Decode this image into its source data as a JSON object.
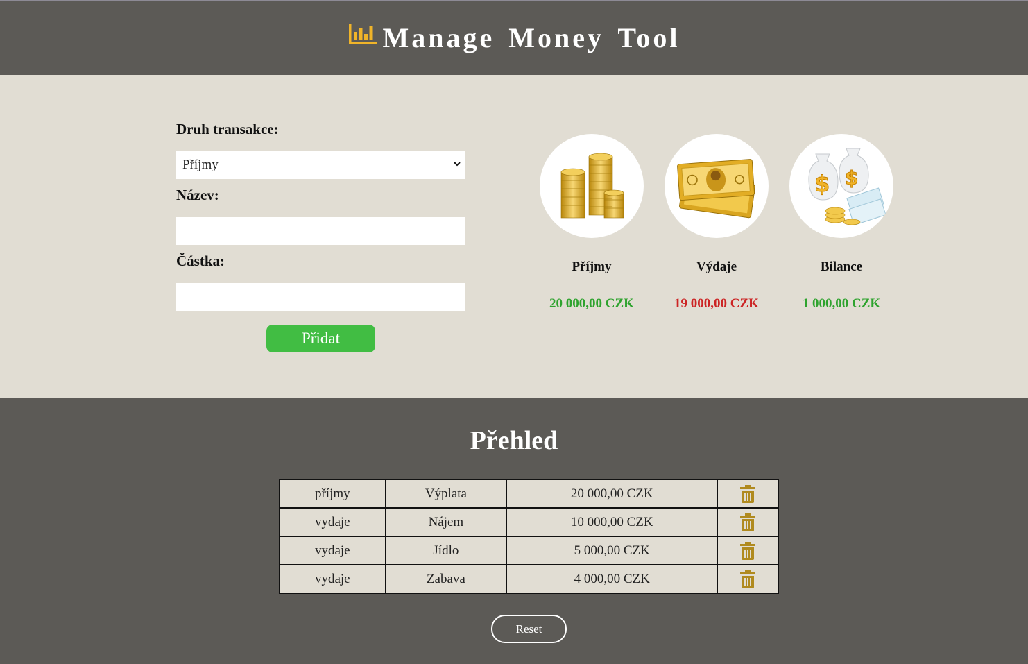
{
  "header": {
    "title": "Manage Money Tool",
    "logo_icon": "bar-chart-icon",
    "logo_color": "#f0b429"
  },
  "form": {
    "type_label": "Druh transakce:",
    "type_selected": "Příjmy",
    "name_label": "Název:",
    "name_value": "",
    "amount_label": "Částka:",
    "amount_value": "",
    "add_label": "Přidat"
  },
  "summary": [
    {
      "label": "Příjmy",
      "value": "20 000,00 CZK",
      "color": "#2ea32e",
      "icon": "coin-stacks-icon"
    },
    {
      "label": "Výdaje",
      "value": "19 000,00 CZK",
      "color": "#cc2424",
      "icon": "gold-banknotes-icon"
    },
    {
      "label": "Bilance",
      "value": "1 000,00 CZK",
      "color": "#2ea32e",
      "icon": "money-bags-icon"
    }
  ],
  "overview": {
    "title": "Přehled",
    "rows": [
      {
        "type": "příjmy",
        "name": "Výplata",
        "amount": "20 000,00 CZK"
      },
      {
        "type": "vydaje",
        "name": "Nájem",
        "amount": "10 000,00 CZK"
      },
      {
        "type": "vydaje",
        "name": "Jídlo",
        "amount": "5 000,00 CZK"
      },
      {
        "type": "vydaje",
        "name": "Zabava",
        "amount": "4 000,00 CZK"
      }
    ],
    "reset_label": "Reset",
    "trash_color": "#b08a1e"
  },
  "colors": {
    "dark_bg": "#5c5a56",
    "light_bg": "#e1ddd3",
    "add_button": "#41bd43"
  }
}
